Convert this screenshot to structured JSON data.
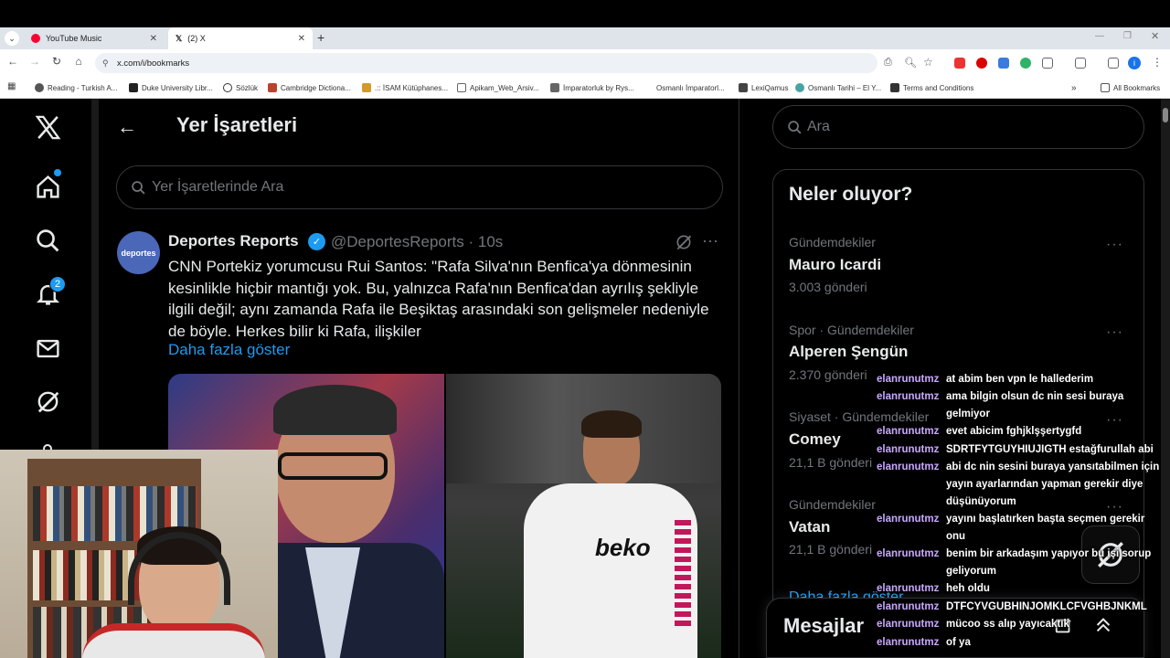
{
  "browser": {
    "tabs": [
      {
        "title": "YouTube Music"
      },
      {
        "title": "(2) X"
      }
    ],
    "new_tab": "+",
    "url": "x.com/i/bookmarks",
    "bookmarks": [
      "Reading - Turkish A...",
      "Duke University Libr...",
      "Sözlük",
      "Cambridge Dictiona...",
      ".:: İSAM Kütüphanes...",
      "Apikam_Web_Arsiv...",
      "İmparatorluk by Rys...",
      "Osmanlı İmparatorl...",
      "LexiQamus",
      "Osmanlı Tarihi – El Y...",
      "Terms and Conditions"
    ],
    "all_bookmarks": "All Bookmarks",
    "profile_initial": "i"
  },
  "sidebar": {
    "notification_count": "2"
  },
  "page": {
    "title": "Yer İşaretleri",
    "search_placeholder": "Yer İşaretlerinde Ara"
  },
  "tweet": {
    "avatar_text": "deportes",
    "name": "Deportes Reports",
    "handle": "@DeportesReports · 10s",
    "text": "CNN Portekiz yorumcusu Rui Santos: \"Rafa Silva'nın Benfica'ya dönmesinin kesinlikle hiçbir mantığı yok. Bu, yalnızca Rafa'nın Benfica'dan ayrılış şekliyle ilgili değil; aynı zamanda Rafa ile Beşiktaş arasındaki son gelişmeler nedeniyle de böyle. Herkes bilir ki Rafa, ilişkiler",
    "show_more": "Daha fazla göster",
    "jersey_text": "beko",
    "more_dots": "···"
  },
  "right": {
    "search_placeholder": "Ara",
    "trends_title": "Neler oluyor?",
    "trends": [
      {
        "meta": "Gündemdekiler",
        "name": "Mauro Icardi",
        "count": "3.003 gönderi"
      },
      {
        "meta": "Spor · Gündemdekiler",
        "name": "Alperen Şengün",
        "count": "2.370 gönderi"
      },
      {
        "meta": "Siyaset · Gündemdekiler",
        "name": "Comey",
        "count": "21,1 B gönderi"
      },
      {
        "meta": "Gündemdekiler",
        "name": "Vatan",
        "count": "21,1 B gönderi"
      }
    ],
    "show_more": "Daha fazla göster",
    "messages_title": "Mesajlar",
    "dots": "···"
  },
  "chat": [
    {
      "user": "elanrunutmz",
      "msg": "at abim ben vpn le hallederim"
    },
    {
      "user": "elanrunutmz",
      "msg": "ama bilgin olsun dc nin sesi buraya gelmiyor"
    },
    {
      "user": "elanrunutmz",
      "msg": "evet abicim fghjklşşertygfd"
    },
    {
      "user": "elanrunutmz",
      "msg": "SDRTFYTGUYHIUJIGTH estağfurullah abi"
    },
    {
      "user": "elanrunutmz",
      "msg": "abi dc nin sesini buraya yansıtabilmen için yayın ayarlarından yapman gerekir diye düşünüyorum"
    },
    {
      "user": "elanrunutmz",
      "msg": "yayını başlatırken başta seçmen gerekir onu"
    },
    {
      "user": "elanrunutmz",
      "msg": "benim bir arkadaşım yapıyor bu işi sorup geliyorum"
    },
    {
      "user": "elanrunutmz",
      "msg": "heh oldu"
    },
    {
      "user": "elanrunutmz",
      "msg": "DTFCYVGUBHINJOMKLCFVGHBJNKML"
    },
    {
      "user": "elanrunutmz",
      "msg": "mücoo ss alıp yayıcaktık"
    },
    {
      "user": "elanrunutmz",
      "msg": "of ya"
    }
  ]
}
